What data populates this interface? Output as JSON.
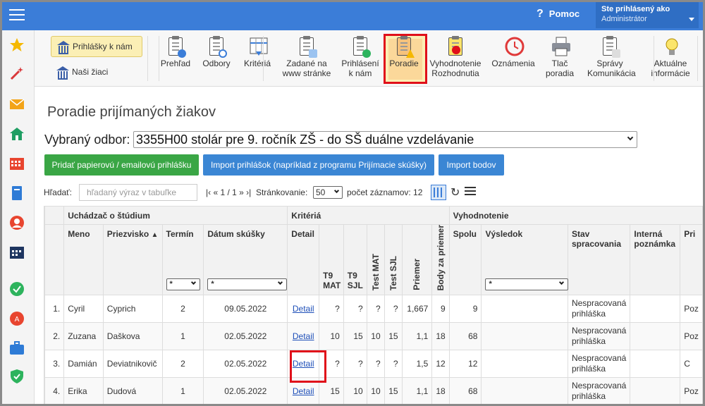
{
  "topbar": {
    "help_label": "Pomoc",
    "help_icon": "question-icon",
    "user_line1": "Ste prihlásený ako",
    "user_line2": "Administrátor"
  },
  "colors": {
    "topbar": "#3b7dd8",
    "highlight": "#e0101a",
    "green_btn": "#3aa645",
    "blue_btn": "#3b86d4",
    "cell_green": "#8ef08b"
  },
  "sidebar": {
    "icons": [
      "star-icon",
      "magic-wand-icon",
      "envelope-icon",
      "home-icon",
      "calendar-grid-icon",
      "book-icon",
      "user-circle-icon",
      "calendar-icon",
      "check-circle-icon",
      "error-icon",
      "briefcase-icon",
      "shield-check-icon"
    ]
  },
  "ribbon": {
    "left": {
      "prihlasky": "Prihlášky k nám",
      "ziaci": "Naši žiaci"
    },
    "items": [
      {
        "l1": "Prehľad",
        "l2": ""
      },
      {
        "l1": "Odbory",
        "l2": ""
      },
      {
        "l1": "Kritériá",
        "l2": ""
      },
      {
        "l1": "Zadané na",
        "l2": "www stránke"
      },
      {
        "l1": "Prihlásení",
        "l2": "k nám"
      },
      {
        "l1": "Poradie",
        "l2": ""
      },
      {
        "l1": "Vyhodnotenie",
        "l2": "Rozhodnutia"
      },
      {
        "l1": "Oznámenia",
        "l2": ""
      },
      {
        "l1": "Tlač",
        "l2": "poradia"
      },
      {
        "l1": "Správy",
        "l2": "Komunikácia"
      },
      {
        "l1": "Aktuálne",
        "l2": "informácie"
      }
    ]
  },
  "page": {
    "title": "Poradie prijímaných žiakov",
    "odbor_label": "Vybraný odbor:",
    "odbor_value": "3355H00 stolár pre 9. ročník ZŠ - do SŠ duálne vzdelávanie"
  },
  "buttons": {
    "paper": "Pridať papierovú / emailovú prihlášku",
    "import": "Import prihlášok (napríklad z programu Prijímacie skúšky)",
    "points": "Import bodov"
  },
  "toolbar": {
    "search_label": "Hľadať:",
    "search_placeholder": "hľadaný výraz v tabuľke",
    "pager": "|‹ « 1 / 1 » ›|",
    "page_size_label": "Stránkovanie:",
    "page_size": "50",
    "count_label": "počet záznamov: 12"
  },
  "table": {
    "groups": {
      "uchadzac": "Uchádzač o štúdium",
      "kriteria": "Kritériá",
      "vyhodnotenie": "Vyhodnotenie"
    },
    "headers": {
      "meno": "Meno",
      "priezvisko": "Priezvisko",
      "sort": "▲",
      "termin": "Termín",
      "datum": "Dátum skúšky",
      "detail": "Detail",
      "t9mat": "T9 MAT",
      "t9sjl": "T9 SJL",
      "testmat": "Test MAT",
      "testsjl": "Test SJL",
      "priemer": "Priemer",
      "body": "Body za priemer",
      "spolu": "Spolu",
      "vysledok": "Výsledok",
      "stav": "Stav spracovania",
      "poznamka": "Interná poznámka",
      "pri": "Pri"
    },
    "filter": "*",
    "rows": [
      {
        "n": "1.",
        "meno": "Cyril",
        "priez": "Cyprich",
        "termin": "2",
        "datum": "09.05.2022",
        "detail": "Detail",
        "t9mat": "?",
        "t9sjl": "?",
        "tmat": "?",
        "tsjl": "?",
        "priemer": "1,667",
        "body": "9",
        "spolu": "9",
        "vysl": "",
        "stav1": "Nespracovaná",
        "stav2": "prihláška",
        "pri": "Poz"
      },
      {
        "n": "2.",
        "meno": "Zuzana",
        "priez": "Daškova",
        "termin": "1",
        "datum": "02.05.2022",
        "detail": "Detail",
        "t9mat": "10",
        "t9sjl": "15",
        "tmat": "10",
        "tsjl": "15",
        "priemer": "1,1",
        "body": "18",
        "spolu": "68",
        "vysl": "",
        "stav1": "Nespracovaná",
        "stav2": "prihláška",
        "pri": "Poz"
      },
      {
        "n": "3.",
        "meno": "Damián",
        "priez": "Deviatnikovič",
        "termin": "2",
        "datum": "02.05.2022",
        "detail": "Detail",
        "t9mat": "?",
        "t9sjl": "?",
        "tmat": "?",
        "tsjl": "?",
        "priemer": "1,5",
        "body": "12",
        "spolu": "12",
        "vysl": "",
        "stav1": "Nespracovaná",
        "stav2": "prihláška",
        "pri": "C"
      },
      {
        "n": "4.",
        "meno": "Erika",
        "priez": "Dudová",
        "termin": "1",
        "datum": "02.05.2022",
        "detail": "Detail",
        "t9mat": "15",
        "t9sjl": "10",
        "tmat": "10",
        "tsjl": "15",
        "priemer": "1,1",
        "body": "18",
        "spolu": "68",
        "vysl": "",
        "stav1": "Nespracovaná",
        "stav2": "prihláška",
        "pri": "Poz"
      }
    ]
  }
}
